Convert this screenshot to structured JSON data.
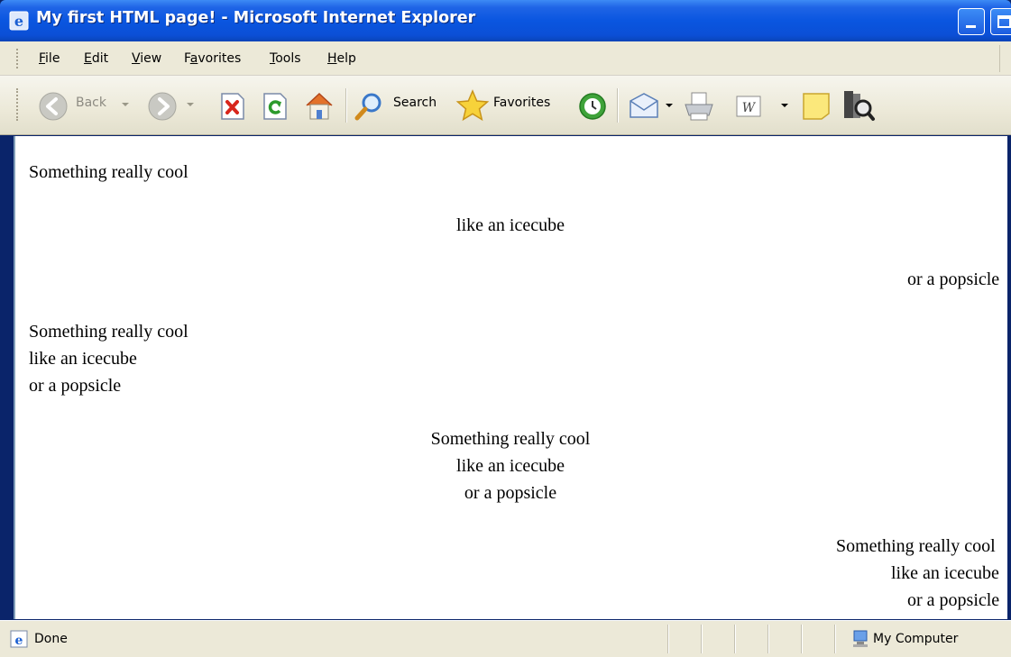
{
  "window": {
    "title": "My first HTML page! - Microsoft Internet Explorer"
  },
  "menu": {
    "items": [
      {
        "label": "File",
        "underline": "F",
        "rest": "ile"
      },
      {
        "label": "Edit",
        "underline": "E",
        "rest": "dit"
      },
      {
        "label": "View",
        "underline": "V",
        "rest": "iew"
      },
      {
        "label": "Favorites",
        "pre": "F",
        "underline": "a",
        "rest": "vorites"
      },
      {
        "label": "Tools",
        "underline": "T",
        "rest": "ools"
      },
      {
        "label": "Help",
        "underline": "H",
        "rest": "elp"
      }
    ]
  },
  "toolbar": {
    "back_label": "Back",
    "search_label": "Search",
    "favorites_label": "Favorites"
  },
  "content": {
    "block1": {
      "left": "Something really cool",
      "center": "like an icecube",
      "right": "or a popsicle"
    },
    "block2": [
      "Something really cool",
      "like an icecube",
      "or a popsicle"
    ],
    "block3": [
      "Something really cool",
      "like an icecube",
      "or a popsicle"
    ],
    "block4": [
      "Something really cool",
      "like an icecube",
      "or a popsicle"
    ]
  },
  "status": {
    "text": "Done",
    "zone": "My Computer"
  },
  "colors": {
    "titlebar": "#0a56e0",
    "chrome": "#ece9d8",
    "content_bg": "#ffffff"
  }
}
